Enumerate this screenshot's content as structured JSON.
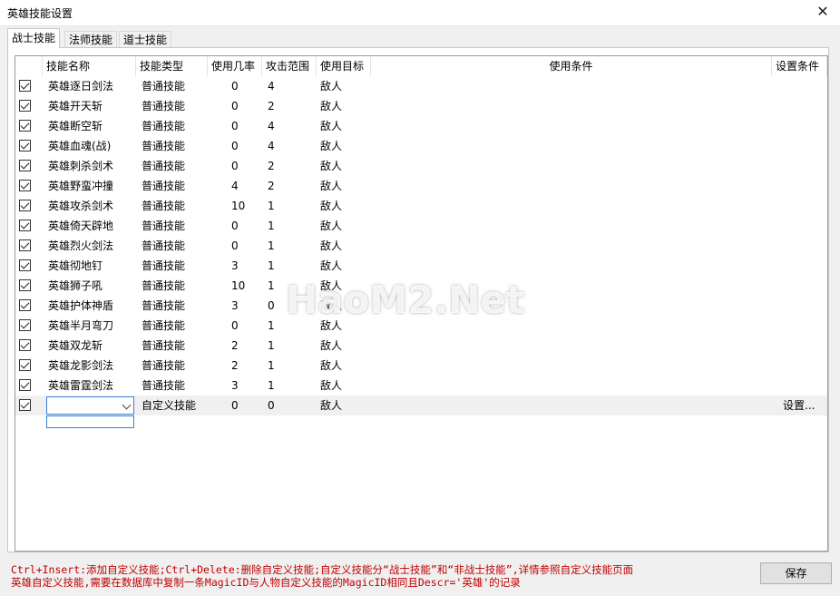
{
  "window": {
    "title": "英雄技能设置"
  },
  "tabs": [
    {
      "label": "战士技能",
      "active": true
    },
    {
      "label": "法师技能",
      "active": false
    },
    {
      "label": "道士技能",
      "active": false
    }
  ],
  "columns": [
    "",
    "技能名称",
    "技能类型",
    "使用几率",
    "攻击范围",
    "使用目标",
    "使用条件",
    "设置条件"
  ],
  "rows": [
    {
      "checked": true,
      "name": "英雄逐日剑法",
      "type": "普通技能",
      "rate": "0",
      "range": "4",
      "target": "敌人",
      "cond": "",
      "setting": ""
    },
    {
      "checked": true,
      "name": "英雄开天斩",
      "type": "普通技能",
      "rate": "0",
      "range": "2",
      "target": "敌人",
      "cond": "",
      "setting": ""
    },
    {
      "checked": true,
      "name": "英雄断空斩",
      "type": "普通技能",
      "rate": "0",
      "range": "4",
      "target": "敌人",
      "cond": "",
      "setting": ""
    },
    {
      "checked": true,
      "name": "英雄血魂(战)",
      "type": "普通技能",
      "rate": "0",
      "range": "4",
      "target": "敌人",
      "cond": "",
      "setting": ""
    },
    {
      "checked": true,
      "name": "英雄刺杀剑术",
      "type": "普通技能",
      "rate": "0",
      "range": "2",
      "target": "敌人",
      "cond": "",
      "setting": ""
    },
    {
      "checked": true,
      "name": "英雄野蛮冲撞",
      "type": "普通技能",
      "rate": "4",
      "range": "2",
      "target": "敌人",
      "cond": "",
      "setting": ""
    },
    {
      "checked": true,
      "name": "英雄攻杀剑术",
      "type": "普通技能",
      "rate": "10",
      "range": "1",
      "target": "敌人",
      "cond": "",
      "setting": ""
    },
    {
      "checked": true,
      "name": "英雄倚天辟地",
      "type": "普通技能",
      "rate": "0",
      "range": "1",
      "target": "敌人",
      "cond": "",
      "setting": ""
    },
    {
      "checked": true,
      "name": "英雄烈火剑法",
      "type": "普通技能",
      "rate": "0",
      "range": "1",
      "target": "敌人",
      "cond": "",
      "setting": ""
    },
    {
      "checked": true,
      "name": "英雄彻地钉",
      "type": "普通技能",
      "rate": "3",
      "range": "1",
      "target": "敌人",
      "cond": "",
      "setting": ""
    },
    {
      "checked": true,
      "name": "英雄狮子吼",
      "type": "普通技能",
      "rate": "10",
      "range": "1",
      "target": "敌人",
      "cond": "",
      "setting": ""
    },
    {
      "checked": true,
      "name": "英雄护体神盾",
      "type": "普通技能",
      "rate": "3",
      "range": "0",
      "target": "敌人",
      "cond": "",
      "setting": ""
    },
    {
      "checked": true,
      "name": "英雄半月弯刀",
      "type": "普通技能",
      "rate": "0",
      "range": "1",
      "target": "敌人",
      "cond": "",
      "setting": ""
    },
    {
      "checked": true,
      "name": "英雄双龙斩",
      "type": "普通技能",
      "rate": "2",
      "range": "1",
      "target": "敌人",
      "cond": "",
      "setting": ""
    },
    {
      "checked": true,
      "name": "英雄龙影剑法",
      "type": "普通技能",
      "rate": "2",
      "range": "1",
      "target": "敌人",
      "cond": "",
      "setting": ""
    },
    {
      "checked": true,
      "name": "英雄雷霆剑法",
      "type": "普通技能",
      "rate": "3",
      "range": "1",
      "target": "敌人",
      "cond": "",
      "setting": ""
    },
    {
      "checked": true,
      "name": "",
      "type": "自定义技能",
      "rate": "0",
      "range": "0",
      "target": "敌人",
      "cond": "",
      "setting": "设置...",
      "editing": true
    }
  ],
  "hints": [
    "Ctrl+Insert:添加自定义技能;Ctrl+Delete:删除自定义技能;自定义技能分“战士技能”和“非战士技能”,详情参照自定义技能页面",
    "英雄自定义技能,需要在数据库中复制一条MagicID与人物自定义技能的MagicID相同且Descr='英雄'的记录"
  ],
  "buttons": {
    "save": "保存"
  },
  "watermark": "HaoM2.Net"
}
